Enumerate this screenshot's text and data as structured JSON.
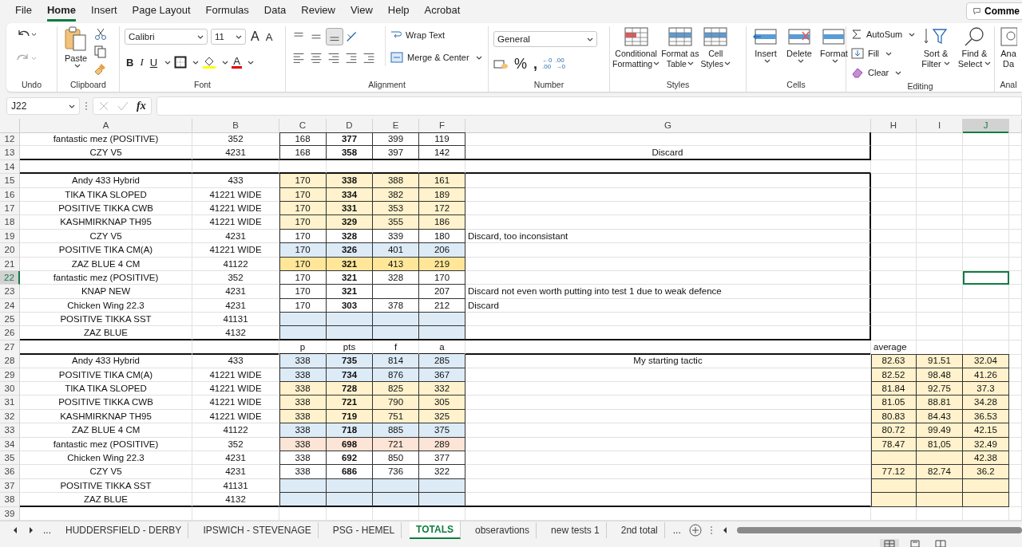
{
  "menu": [
    {
      "label": "File",
      "selected": false
    },
    {
      "label": "Home",
      "selected": true
    },
    {
      "label": "Insert",
      "selected": false
    },
    {
      "label": "Page Layout",
      "selected": false
    },
    {
      "label": "Formulas",
      "selected": false
    },
    {
      "label": "Data",
      "selected": false
    },
    {
      "label": "Review",
      "selected": false
    },
    {
      "label": "View",
      "selected": false
    },
    {
      "label": "Help",
      "selected": false
    },
    {
      "label": "Acrobat",
      "selected": false
    }
  ],
  "comments_button": "Comme",
  "ribbon": {
    "undo": {
      "label": "Undo"
    },
    "clipboard": {
      "paste": "Paste",
      "label": "Clipboard"
    },
    "font": {
      "family": "Calibri",
      "size": "11",
      "grow": "A",
      "shrink": "A",
      "bold": "B",
      "italic": "I",
      "underline": "U",
      "color_letter": "A",
      "label": "Font"
    },
    "alignment": {
      "wrap": "Wrap Text",
      "merge": "Merge & Center",
      "label": "Alignment"
    },
    "number": {
      "format": "General",
      "percent": "%",
      "comma": ",",
      "increase_decimal": [
        "←0",
        ".00"
      ],
      "decrease_decimal": [
        ".00",
        "→0"
      ],
      "label": "Number"
    },
    "styles": {
      "buttons": [
        {
          "lines": [
            "Conditional",
            "Formatting"
          ]
        },
        {
          "lines": [
            "Format as",
            "Table"
          ]
        },
        {
          "lines": [
            "Cell",
            "Styles"
          ]
        }
      ],
      "label": "Styles"
    },
    "cells": {
      "buttons": [
        "Insert",
        "Delete",
        "Format"
      ],
      "label": "Cells"
    },
    "editing": {
      "autosum": "AutoSum",
      "fill": "Fill",
      "clear": "Clear",
      "sort": [
        "Sort &",
        "Filter"
      ],
      "find": [
        "Find &",
        "Select"
      ],
      "label": "Editing"
    },
    "analysis": {
      "button": [
        "Ana",
        "Da"
      ],
      "label": "Anal"
    }
  },
  "formula_bar": {
    "name_box": "J22",
    "fx": "fx"
  },
  "sheet": {
    "columns": [
      {
        "label": "A",
        "selected": false
      },
      {
        "label": "B",
        "selected": false
      },
      {
        "label": "C",
        "selected": false
      },
      {
        "label": "D",
        "selected": false
      },
      {
        "label": "E",
        "selected": false
      },
      {
        "label": "F",
        "selected": false
      },
      {
        "label": "G",
        "selected": false
      },
      {
        "label": "H",
        "selected": false
      },
      {
        "label": "I",
        "selected": false
      },
      {
        "label": "J",
        "selected": true
      }
    ],
    "rows": [
      {
        "number": "12",
        "selected": false,
        "framed": true,
        "cells": [
          {
            "value": "fantastic mez (POSITIVE)"
          },
          {
            "value": "352"
          },
          {
            "value": "168",
            "boxed": true
          },
          {
            "value": "377",
            "boxed": true,
            "bold": true
          },
          {
            "value": "399",
            "boxed": true
          },
          {
            "value": "119",
            "boxed": true
          }
        ]
      },
      {
        "number": "13",
        "selected": false,
        "framed": true,
        "rule_below": true,
        "cells": [
          {
            "value": "CZY V5"
          },
          {
            "value": "4231"
          },
          {
            "value": "168",
            "boxed": true
          },
          {
            "value": "358",
            "boxed": true,
            "bold": true
          },
          {
            "value": "397",
            "boxed": true
          },
          {
            "value": "142",
            "boxed": true
          },
          {
            "value": "Discard"
          }
        ]
      },
      {
        "number": "14",
        "selected": false,
        "rule_below": true
      },
      {
        "number": "15",
        "selected": false,
        "framed": true,
        "cells": [
          {
            "value": "Andy 433 Hybrid"
          },
          {
            "value": "433"
          },
          {
            "value": "170",
            "boxed": true,
            "color": "#fff2cc"
          },
          {
            "value": "338",
            "boxed": true,
            "bold": true,
            "color": "#fff2cc"
          },
          {
            "value": "388",
            "boxed": true,
            "color": "#fff2cc"
          },
          {
            "value": "161",
            "boxed": true,
            "color": "#fff2cc"
          }
        ]
      },
      {
        "number": "16",
        "selected": false,
        "framed": true,
        "cells": [
          {
            "value": "TIKA TIKA SLOPED"
          },
          {
            "value": "41221 WIDE"
          },
          {
            "value": "170",
            "boxed": true,
            "color": "#fff2cc"
          },
          {
            "value": "334",
            "boxed": true,
            "bold": true,
            "color": "#fff2cc"
          },
          {
            "value": "382",
            "boxed": true,
            "color": "#fff2cc"
          },
          {
            "value": "189",
            "boxed": true,
            "color": "#fff2cc"
          }
        ]
      },
      {
        "number": "17",
        "selected": false,
        "framed": true,
        "cells": [
          {
            "value": "POSITIVE TIKKA CWB"
          },
          {
            "value": "41221 WIDE"
          },
          {
            "value": "170",
            "boxed": true,
            "color": "#fff2cc"
          },
          {
            "value": "331",
            "boxed": true,
            "bold": true,
            "color": "#fff2cc"
          },
          {
            "value": "353",
            "boxed": true,
            "color": "#fff2cc"
          },
          {
            "value": "172",
            "boxed": true,
            "color": "#fff2cc"
          }
        ]
      },
      {
        "number": "18",
        "selected": false,
        "framed": true,
        "cells": [
          {
            "value": "KASHMIRKNAP TH95"
          },
          {
            "value": "41221 WIDE"
          },
          {
            "value": "170",
            "boxed": true,
            "color": "#fff2cc"
          },
          {
            "value": "329",
            "boxed": true,
            "bold": true,
            "color": "#fff2cc"
          },
          {
            "value": "355",
            "boxed": true,
            "color": "#fff2cc"
          },
          {
            "value": "186",
            "boxed": true,
            "color": "#fff2cc"
          }
        ]
      },
      {
        "number": "19",
        "selected": false,
        "framed": true,
        "cells": [
          {
            "value": "CZY V5"
          },
          {
            "value": "4231"
          },
          {
            "value": "170",
            "boxed": true
          },
          {
            "value": "328",
            "boxed": true,
            "bold": true
          },
          {
            "value": "339",
            "boxed": true
          },
          {
            "value": "180",
            "boxed": true
          },
          {
            "value": "Discard, too inconsistant",
            "left_aligned": true
          }
        ]
      },
      {
        "number": "20",
        "selected": false,
        "framed": true,
        "cells": [
          {
            "value": "POSITIVE TIKA CM(A)"
          },
          {
            "value": "41221 WIDE"
          },
          {
            "value": "170",
            "boxed": true,
            "color": "#ddebf7"
          },
          {
            "value": "326",
            "boxed": true,
            "bold": true,
            "color": "#ddebf7"
          },
          {
            "value": "401",
            "boxed": true,
            "color": "#ddebf7"
          },
          {
            "value": "206",
            "boxed": true,
            "color": "#ddebf7"
          }
        ]
      },
      {
        "number": "21",
        "selected": false,
        "framed": true,
        "cells": [
          {
            "value": "ZAZ BLUE 4 CM"
          },
          {
            "value": "41122"
          },
          {
            "value": "170",
            "boxed": true,
            "color": "#ffe699"
          },
          {
            "value": "321",
            "boxed": true,
            "bold": true,
            "color": "#ffe699"
          },
          {
            "value": "413",
            "boxed": true,
            "color": "#ffe699"
          },
          {
            "value": "219",
            "boxed": true,
            "color": "#ffe699"
          }
        ]
      },
      {
        "number": "22",
        "selected": true,
        "framed": true,
        "cells": [
          {
            "value": "fantastic mez (POSITIVE)"
          },
          {
            "value": "352"
          },
          {
            "value": "170",
            "boxed": true
          },
          {
            "value": "321",
            "boxed": true,
            "bold": true
          },
          {
            "value": "328",
            "boxed": true
          },
          {
            "value": "170",
            "boxed": true
          },
          {},
          {},
          {},
          {
            "selected": true
          }
        ]
      },
      {
        "number": "23",
        "selected": false,
        "framed": true,
        "cells": [
          {
            "value": "KNAP NEW"
          },
          {
            "value": "4231"
          },
          {
            "value": "170",
            "boxed": true
          },
          {
            "value": "321",
            "boxed": true,
            "bold": true
          },
          {
            "boxed": true
          },
          {
            "value": "207",
            "boxed": true
          },
          {
            "value": "Discard not even worth putting into test 1 due to weak defence",
            "left_aligned": true
          }
        ]
      },
      {
        "number": "24",
        "selected": false,
        "framed": true,
        "cells": [
          {
            "value": "Chicken Wing 22.3"
          },
          {
            "value": "4231"
          },
          {
            "value": "170",
            "boxed": true
          },
          {
            "value": "303",
            "boxed": true,
            "bold": true
          },
          {
            "value": "378",
            "boxed": true
          },
          {
            "value": "212",
            "boxed": true
          },
          {
            "value": "Discard",
            "left_aligned": true
          }
        ]
      },
      {
        "number": "25",
        "selected": false,
        "framed": true,
        "cells": [
          {
            "value": "POSITIVE TIKKA SST"
          },
          {
            "value": "41131"
          },
          {
            "boxed": true,
            "color": "#ddebf7"
          },
          {
            "boxed": true,
            "color": "#ddebf7"
          },
          {
            "boxed": true,
            "color": "#ddebf7"
          },
          {
            "boxed": true,
            "color": "#ddebf7"
          }
        ]
      },
      {
        "number": "26",
        "selected": false,
        "framed": true,
        "rule_below": true,
        "cells": [
          {
            "value": "ZAZ BLUE"
          },
          {
            "value": "4132"
          },
          {
            "boxed": true,
            "color": "#ddebf7"
          },
          {
            "boxed": true,
            "color": "#ddebf7"
          },
          {
            "boxed": true,
            "color": "#ddebf7"
          },
          {
            "boxed": true,
            "color": "#ddebf7"
          }
        ]
      },
      {
        "number": "27",
        "selected": false,
        "rule_below": true,
        "cells": [
          {},
          {},
          {
            "value": "p"
          },
          {
            "value": "pts"
          },
          {
            "value": "f"
          },
          {
            "value": "a"
          },
          {},
          {
            "value": "average",
            "left_aligned": true
          }
        ]
      },
      {
        "number": "28",
        "selected": false,
        "cells": [
          {
            "value": "Andy 433 Hybrid"
          },
          {
            "value": "433"
          },
          {
            "value": "338",
            "boxed": true,
            "color": "#ddebf7"
          },
          {
            "value": "735",
            "boxed": true,
            "bold": true,
            "color": "#ddebf7"
          },
          {
            "value": "814",
            "boxed": true,
            "color": "#ddebf7"
          },
          {
            "value": "285",
            "boxed": true,
            "color": "#ddebf7"
          },
          {
            "value": "My starting tactic"
          },
          {
            "value": "82.63",
            "boxed": true,
            "color": "#fff2cc"
          },
          {
            "value": "91.51",
            "boxed": true,
            "color": "#fff2cc"
          },
          {
            "value": "32.04",
            "boxed": true,
            "color": "#fff2cc"
          }
        ]
      },
      {
        "number": "29",
        "selected": false,
        "cells": [
          {
            "value": "POSITIVE TIKA CM(A)"
          },
          {
            "value": "41221 WIDE"
          },
          {
            "value": "338",
            "boxed": true,
            "color": "#ddebf7"
          },
          {
            "value": "734",
            "boxed": true,
            "bold": true,
            "color": "#ddebf7"
          },
          {
            "value": "876",
            "boxed": true,
            "color": "#ddebf7"
          },
          {
            "value": "367",
            "boxed": true,
            "color": "#ddebf7"
          },
          {},
          {
            "value": "82.52",
            "boxed": true,
            "color": "#fff2cc"
          },
          {
            "value": "98.48",
            "boxed": true,
            "color": "#fff2cc"
          },
          {
            "value": "41.26",
            "boxed": true,
            "color": "#fff2cc"
          }
        ]
      },
      {
        "number": "30",
        "selected": false,
        "cells": [
          {
            "value": "TIKA TIKA SLOPED"
          },
          {
            "value": "41221 WIDE"
          },
          {
            "value": "338",
            "boxed": true,
            "color": "#fff2cc"
          },
          {
            "value": "728",
            "boxed": true,
            "bold": true,
            "color": "#fff2cc"
          },
          {
            "value": "825",
            "boxed": true,
            "color": "#fff2cc"
          },
          {
            "value": "332",
            "boxed": true,
            "color": "#fff2cc"
          },
          {},
          {
            "value": "81.84",
            "boxed": true,
            "color": "#fff2cc"
          },
          {
            "value": "92.75",
            "boxed": true,
            "color": "#fff2cc"
          },
          {
            "value": "37.3",
            "boxed": true,
            "color": "#fff2cc"
          }
        ]
      },
      {
        "number": "31",
        "selected": false,
        "cells": [
          {
            "value": "POSITIVE TIKKA CWB"
          },
          {
            "value": "41221 WIDE"
          },
          {
            "value": "338",
            "boxed": true,
            "color": "#fff2cc"
          },
          {
            "value": "721",
            "boxed": true,
            "bold": true,
            "color": "#fff2cc"
          },
          {
            "value": "790",
            "boxed": true,
            "color": "#fff2cc"
          },
          {
            "value": "305",
            "boxed": true,
            "color": "#fff2cc"
          },
          {},
          {
            "value": "81.05",
            "boxed": true,
            "color": "#fff2cc"
          },
          {
            "value": "88.81",
            "boxed": true,
            "color": "#fff2cc"
          },
          {
            "value": "34.28",
            "boxed": true,
            "color": "#fff2cc"
          }
        ]
      },
      {
        "number": "32",
        "selected": false,
        "cells": [
          {
            "value": "KASHMIRKNAP TH95"
          },
          {
            "value": "41221 WIDE"
          },
          {
            "value": "338",
            "boxed": true,
            "color": "#fff2cc"
          },
          {
            "value": "719",
            "boxed": true,
            "bold": true,
            "color": "#fff2cc"
          },
          {
            "value": "751",
            "boxed": true,
            "color": "#fff2cc"
          },
          {
            "value": "325",
            "boxed": true,
            "color": "#fff2cc"
          },
          {},
          {
            "value": "80.83",
            "boxed": true,
            "color": "#fff2cc"
          },
          {
            "value": "84.43",
            "boxed": true,
            "color": "#fff2cc"
          },
          {
            "value": "36.53",
            "boxed": true,
            "color": "#fff2cc"
          }
        ]
      },
      {
        "number": "33",
        "selected": false,
        "cells": [
          {
            "value": "ZAZ BLUE 4 CM"
          },
          {
            "value": "41122"
          },
          {
            "value": "338",
            "boxed": true,
            "color": "#ddebf7"
          },
          {
            "value": "718",
            "boxed": true,
            "bold": true,
            "color": "#ddebf7"
          },
          {
            "value": "885",
            "boxed": true,
            "color": "#ddebf7"
          },
          {
            "value": "375",
            "boxed": true,
            "color": "#ddebf7"
          },
          {},
          {
            "value": "80.72",
            "boxed": true,
            "color": "#fff2cc"
          },
          {
            "value": "99.49",
            "boxed": true,
            "color": "#fff2cc"
          },
          {
            "value": "42.15",
            "boxed": true,
            "color": "#fff2cc"
          }
        ]
      },
      {
        "number": "34",
        "selected": false,
        "cells": [
          {
            "value": "fantastic mez (POSITIVE)"
          },
          {
            "value": "352"
          },
          {
            "value": "338",
            "boxed": true,
            "color": "#fce4d6"
          },
          {
            "value": "698",
            "boxed": true,
            "bold": true,
            "color": "#fce4d6"
          },
          {
            "value": "721",
            "boxed": true,
            "color": "#fce4d6"
          },
          {
            "value": "289",
            "boxed": true,
            "color": "#fce4d6"
          },
          {},
          {
            "value": "78.47",
            "boxed": true,
            "color": "#fff2cc"
          },
          {
            "value": "81,05",
            "boxed": true,
            "color": "#fff2cc"
          },
          {
            "value": "32.49",
            "boxed": true,
            "color": "#fff2cc"
          }
        ]
      },
      {
        "number": "35",
        "selected": false,
        "cells": [
          {
            "value": "Chicken Wing 22.3"
          },
          {
            "value": "4231"
          },
          {
            "value": "338",
            "boxed": true
          },
          {
            "value": "692",
            "boxed": true,
            "bold": true
          },
          {
            "value": "850",
            "boxed": true
          },
          {
            "value": "377",
            "boxed": true
          },
          {},
          {
            "boxed": true,
            "color": "#fff2cc"
          },
          {
            "boxed": true,
            "color": "#fff2cc"
          },
          {
            "value": "42.38",
            "boxed": true,
            "color": "#fff2cc"
          }
        ]
      },
      {
        "number": "36",
        "selected": false,
        "cells": [
          {
            "value": "CZY V5"
          },
          {
            "value": "4231"
          },
          {
            "value": "338",
            "boxed": true
          },
          {
            "value": "686",
            "boxed": true,
            "bold": true
          },
          {
            "value": "736",
            "boxed": true
          },
          {
            "value": "322",
            "boxed": true
          },
          {},
          {
            "value": "77.12",
            "boxed": true,
            "color": "#fff2cc"
          },
          {
            "value": "82.74",
            "boxed": true,
            "color": "#fff2cc"
          },
          {
            "value": "36.2",
            "boxed": true,
            "color": "#fff2cc"
          }
        ]
      },
      {
        "number": "37",
        "selected": false,
        "cells": [
          {
            "value": "POSITIVE TIKKA SST"
          },
          {
            "value": "41131"
          },
          {
            "boxed": true,
            "color": "#ddebf7"
          },
          {
            "boxed": true,
            "color": "#ddebf7"
          },
          {
            "boxed": true,
            "color": "#ddebf7"
          },
          {
            "boxed": true,
            "color": "#ddebf7"
          },
          {},
          {
            "boxed": true,
            "color": "#fff2cc"
          },
          {
            "boxed": true,
            "color": "#fff2cc"
          },
          {
            "boxed": true,
            "color": "#fff2cc"
          }
        ]
      },
      {
        "number": "38",
        "selected": false,
        "rule_below": true,
        "cells": [
          {
            "value": "ZAZ BLUE"
          },
          {
            "value": "4132"
          },
          {
            "boxed": true,
            "color": "#ddebf7"
          },
          {
            "boxed": true,
            "color": "#ddebf7"
          },
          {
            "boxed": true,
            "color": "#ddebf7"
          },
          {
            "boxed": true,
            "color": "#ddebf7"
          },
          {},
          {
            "boxed": true,
            "color": "#fff2cc"
          },
          {
            "boxed": true,
            "color": "#fff2cc"
          },
          {
            "boxed": true,
            "color": "#fff2cc"
          }
        ]
      },
      {
        "number": "39",
        "selected": false
      }
    ]
  },
  "sheet_tabs": {
    "more": "...",
    "tabs": [
      {
        "label": "HUDDERSFIELD - DERBY",
        "selected": false
      },
      {
        "label": "IPSWICH - STEVENAGE",
        "selected": false
      },
      {
        "label": "PSG - HEMEL",
        "selected": false
      },
      {
        "label": "TOTALS",
        "selected": true
      },
      {
        "label": "obseravtions",
        "selected": false
      },
      {
        "label": "new tests 1",
        "selected": false
      },
      {
        "label": "2nd total",
        "selected": false
      }
    ],
    "more_right": "..."
  }
}
